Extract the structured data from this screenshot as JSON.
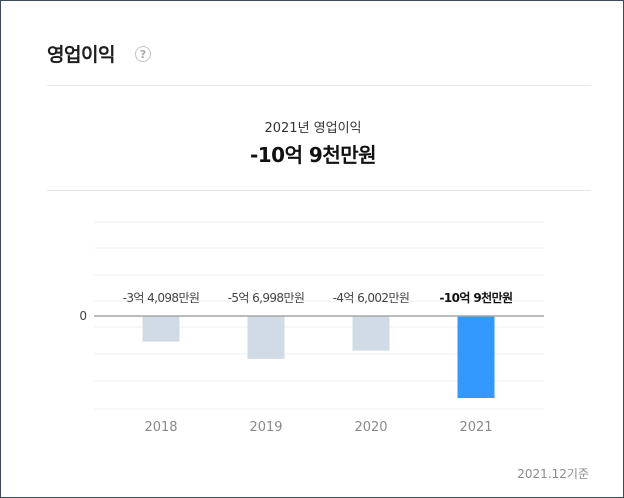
{
  "header": {
    "title": "영업이익",
    "help_icon": "question-circle-icon",
    "help_glyph": "?"
  },
  "summary": {
    "label": "2021년 영업이익",
    "value": "-10억 9천만원"
  },
  "footnote": "2021.12기준",
  "chart_data": {
    "type": "bar",
    "categories": [
      "2018",
      "2019",
      "2020",
      "2021"
    ],
    "values": [
      -34098,
      -56998,
      -46002,
      -109000
    ],
    "value_unit": "만원",
    "labels": [
      "-3억 4,098만원",
      "-5억 6,998만원",
      "-4억 6,002만원",
      "-10억 9천만원"
    ],
    "zero_tick_label": "0",
    "highlight_index": 3,
    "colors": {
      "default": "#d1dbe5",
      "highlight": "#3399ff",
      "zero_line": "#a6a6a6",
      "grid": "#efefef"
    },
    "grid": true
  }
}
